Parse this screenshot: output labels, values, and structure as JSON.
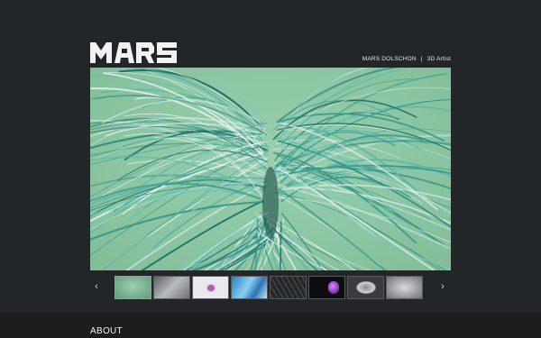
{
  "header": {
    "logo_text": "MARS",
    "artist_name": "MARS DOLSCHON",
    "separator": "|",
    "artist_role": "3D Artist"
  },
  "gallery": {
    "prev_icon": "chevron-left-icon",
    "next_icon": "chevron-right-icon",
    "prev_glyph": "‹",
    "next_glyph": "›",
    "active_index": 0,
    "thumb_count": 8
  },
  "footer": {
    "about_label": "ABOUT"
  },
  "colors": {
    "background": "#232628",
    "footer": "#1b1d1e",
    "hero_bg": "#8ec8a4",
    "hair_accent": "#2f8f82"
  }
}
